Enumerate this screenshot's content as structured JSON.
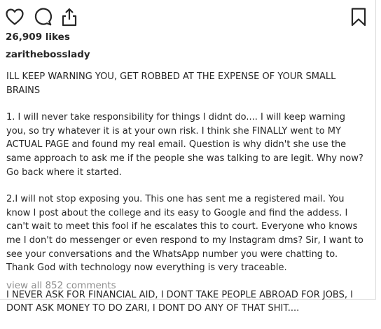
{
  "actions": {
    "like_icon": "heart-icon",
    "comment_icon": "comment-icon",
    "share_icon": "share-icon",
    "save_icon": "bookmark-icon"
  },
  "post": {
    "likes": "26,909 likes",
    "username": "zarithebosslady",
    "caption": [
      "ILL KEEP WARNING YOU, GET ROBBED AT THE EXPENSE OF YOUR SMALL BRAINS",
      "1. I will never take responsibility for things I didnt do.... I will keep warning you, so try whatever it is at your own risk. I think she FINALLY went to MY ACTUAL PAGE and found my real email. Question is why didn't she use the same approach to ask me if the people she was talking to are legit. Why now? Go back where it started.",
      "2.I will not stop exposing you. This one has sent me a registered mail. You know I post about the college and its easy to Google and find the addess. I can't wait to meet this fool if he escalates this to court. Everyone who knows me I don't do messenger or even respond to my Instagram dms? Sir, I want to see your conversations and the WhatsApp number you were chatting to. Thank God with technology now everything is very traceable.",
      "I NEVER ASK FOR FINANCIAL AID, I DONT TAKE PEOPLE ABROAD FOR JOBS, I DONT ASK MONEY TO DO ZARI, I DONT DO ANY OF THAT SHIT...."
    ],
    "view_comments": "view all 852 comments"
  },
  "colors": {
    "text": "#262626",
    "muted": "#8e8e8e",
    "border": "#dbdbdb"
  }
}
